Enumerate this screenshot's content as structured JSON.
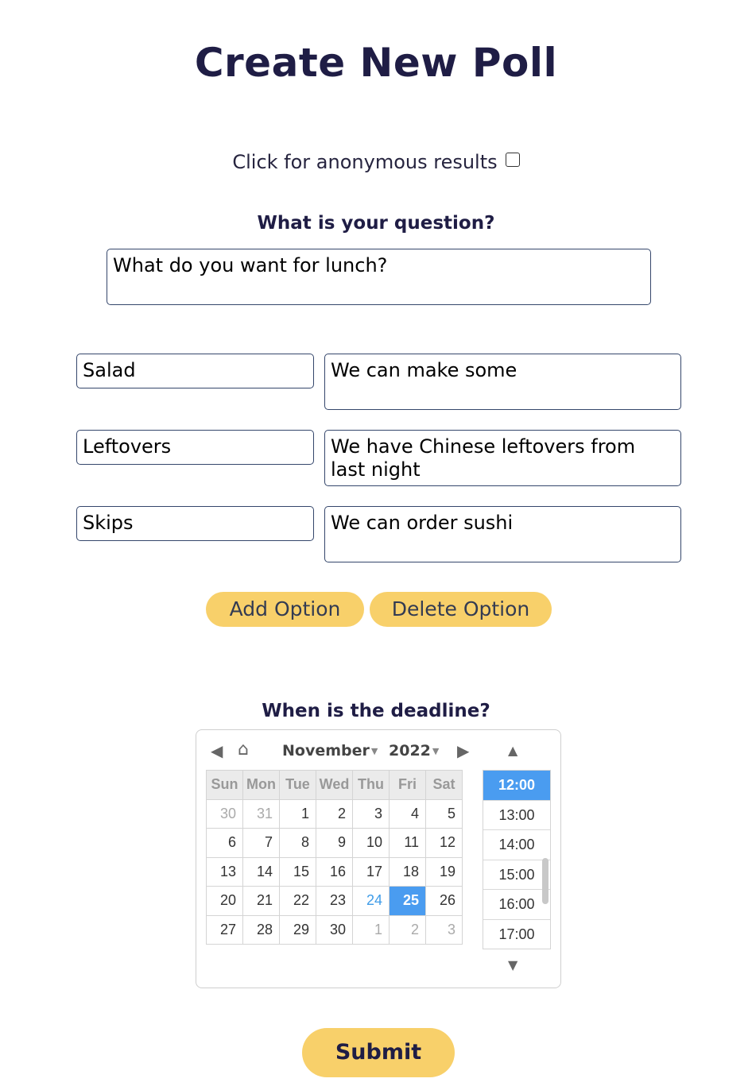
{
  "title": "Create New Poll",
  "anonymous": {
    "label": "Click for anonymous results",
    "checked": false
  },
  "question": {
    "label": "What is your question?",
    "value": "What do you want for lunch?"
  },
  "options": [
    {
      "name": "Salad",
      "description": "We can make some"
    },
    {
      "name": "Leftovers",
      "description": "We have Chinese leftovers from last night"
    },
    {
      "name": "Skips",
      "description": "We can order sushi"
    }
  ],
  "buttons": {
    "add_option": "Add Option",
    "delete_option": "Delete Option",
    "submit": "Submit"
  },
  "deadline": {
    "label": "When is the deadline?",
    "month": "November",
    "year": "2022",
    "weekdays": [
      "Sun",
      "Mon",
      "Tue",
      "Wed",
      "Thu",
      "Fri",
      "Sat"
    ],
    "weeks": [
      [
        "30",
        "31",
        "1",
        "2",
        "3",
        "4",
        "5"
      ],
      [
        "6",
        "7",
        "8",
        "9",
        "10",
        "11",
        "12"
      ],
      [
        "13",
        "14",
        "15",
        "16",
        "17",
        "18",
        "19"
      ],
      [
        "20",
        "21",
        "22",
        "23",
        "24",
        "25",
        "26"
      ],
      [
        "27",
        "28",
        "29",
        "30",
        "1",
        "2",
        "3"
      ]
    ],
    "today": "24",
    "selected_day": "25",
    "times": [
      "12:00",
      "13:00",
      "14:00",
      "15:00",
      "16:00",
      "17:00"
    ],
    "selected_time": "12:00",
    "colors": {
      "selected": "#4a9cf0",
      "today": "#3f9ce8",
      "button": "#f8d06a"
    }
  }
}
